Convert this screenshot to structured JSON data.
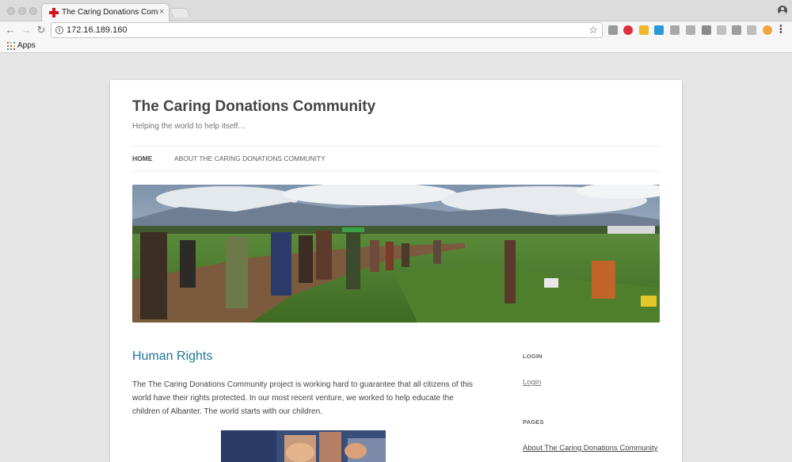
{
  "browser": {
    "tab_title": "The Caring Donations Commu",
    "tab_close": "×",
    "url": "172.16.189.160",
    "bookmarks": {
      "apps_label": "Apps"
    },
    "extension_colors": [
      "#9a9a9a",
      "#e0303a",
      "#f2b62a",
      "#2b9ad4",
      "#a8a8a8",
      "#b0b0b0",
      "#8a8a8a",
      "#c0c0c0",
      "#9c9c9c",
      "#bdbdbd",
      "#f0a640"
    ]
  },
  "site": {
    "title": "The Caring Donations Community",
    "description": "Helping the world to help itself…",
    "nav": [
      {
        "label": "Home",
        "active": true
      },
      {
        "label": "About The Caring Donations Community",
        "active": false
      }
    ]
  },
  "post": {
    "title": "Human Rights",
    "paragraph": "The The Caring Donations Community project is working hard to guarantee that all citizens of this world have their rights protected.  In our most recent venture, we worked to help educate the children of Albanter.  The world starts with our children."
  },
  "sidebar": {
    "login_title": "Login",
    "login_link": "Login",
    "pages_title": "Pages",
    "pages_link": "About The Caring Donations Community"
  },
  "colors": {
    "link": "#21759b",
    "title": "#444444",
    "page_bg": "#e6e6e6"
  }
}
